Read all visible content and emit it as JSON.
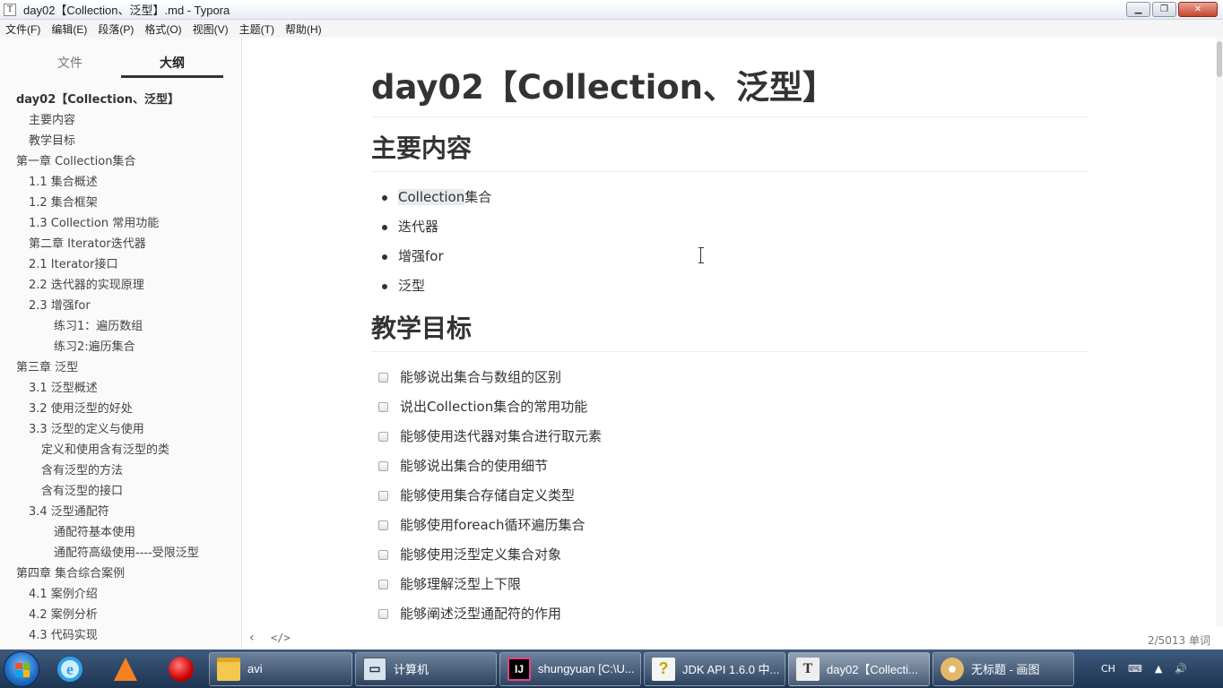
{
  "window": {
    "icon_letter": "T",
    "title": "day02【Collection、泛型】.md - Typora",
    "min_glyph": "▁",
    "restore_glyph": "❐",
    "close_glyph": "✕"
  },
  "menu": [
    "文件(F)",
    "编辑(E)",
    "段落(P)",
    "格式(O)",
    "视图(V)",
    "主题(T)",
    "帮助(H)"
  ],
  "sidebar": {
    "tabs": {
      "files": "文件",
      "outline": "大纲"
    },
    "outline": [
      {
        "text": "day02【Collection、泛型】",
        "level": 1
      },
      {
        "text": "主要内容",
        "level": 2
      },
      {
        "text": "教学目标",
        "level": 2
      },
      {
        "text": "第一章 Collection集合",
        "level": 1
      },
      {
        "text": "1.1 集合概述",
        "level": 2
      },
      {
        "text": "1.2 集合框架",
        "level": 2
      },
      {
        "text": "1.3 Collection 常用功能",
        "level": 2
      },
      {
        "text": "第二章 Iterator迭代器",
        "level": 2
      },
      {
        "text": "2.1 Iterator接口",
        "level": 2
      },
      {
        "text": "2.2 迭代器的实现原理",
        "level": 2
      },
      {
        "text": "2.3 增强for",
        "level": 2
      },
      {
        "text": "练习1：遍历数组",
        "level": 4
      },
      {
        "text": "练习2:遍历集合",
        "level": 4
      },
      {
        "text": "第三章 泛型",
        "level": 1
      },
      {
        "text": "3.1 泛型概述",
        "level": 2
      },
      {
        "text": "3.2 使用泛型的好处",
        "level": 2
      },
      {
        "text": "3.3 泛型的定义与使用",
        "level": 2
      },
      {
        "text": "定义和使用含有泛型的类",
        "level": 3
      },
      {
        "text": "含有泛型的方法",
        "level": 3
      },
      {
        "text": "含有泛型的接口",
        "level": 3
      },
      {
        "text": "3.4 泛型通配符",
        "level": 2
      },
      {
        "text": "通配符基本使用",
        "level": 4
      },
      {
        "text": "通配符高级使用----受限泛型",
        "level": 4
      },
      {
        "text": "第四章 集合综合案例",
        "level": 1
      },
      {
        "text": "4.1 案例介绍",
        "level": 2
      },
      {
        "text": "4.2 案例分析",
        "level": 2
      },
      {
        "text": "4.3 代码实现",
        "level": 2
      }
    ]
  },
  "document": {
    "title": "day02【Collection、泛型】",
    "section1": {
      "heading": "主要内容",
      "first_item_highlight": "Collection",
      "first_item_rest": "集合",
      "items": [
        "迭代器",
        "增强for",
        "泛型"
      ]
    },
    "section2": {
      "heading": "教学目标",
      "tasks": [
        "能够说出集合与数组的区别",
        "说出Collection集合的常用功能",
        "能够使用迭代器对集合进行取元素",
        "能够说出集合的使用细节",
        "能够使用集合存储自定义类型",
        "能够使用foreach循环遍历集合",
        "能够使用泛型定义集合对象",
        "能够理解泛型上下限",
        "能够阐述泛型通配符的作用"
      ]
    }
  },
  "statusbar": {
    "back_glyph": "‹",
    "source_glyph": "</>",
    "word_count": "2/5013 单词"
  },
  "taskbar": {
    "tasks": [
      {
        "label": "avi",
        "icon": "folder-icon"
      },
      {
        "label": "计算机",
        "icon": "computer-icon"
      },
      {
        "label": "shungyuan [C:\\U...",
        "icon": "intellij-icon"
      },
      {
        "label": "JDK API 1.6.0 中...",
        "icon": "help-icon"
      },
      {
        "label": "day02【Collecti...",
        "icon": "typora-icon"
      },
      {
        "label": "无标题 - 画图",
        "icon": "paint-icon"
      }
    ],
    "tray": {
      "ime": "CH",
      "keyboard": "⌨",
      "arrow": "▲",
      "volume": "🔊"
    }
  }
}
